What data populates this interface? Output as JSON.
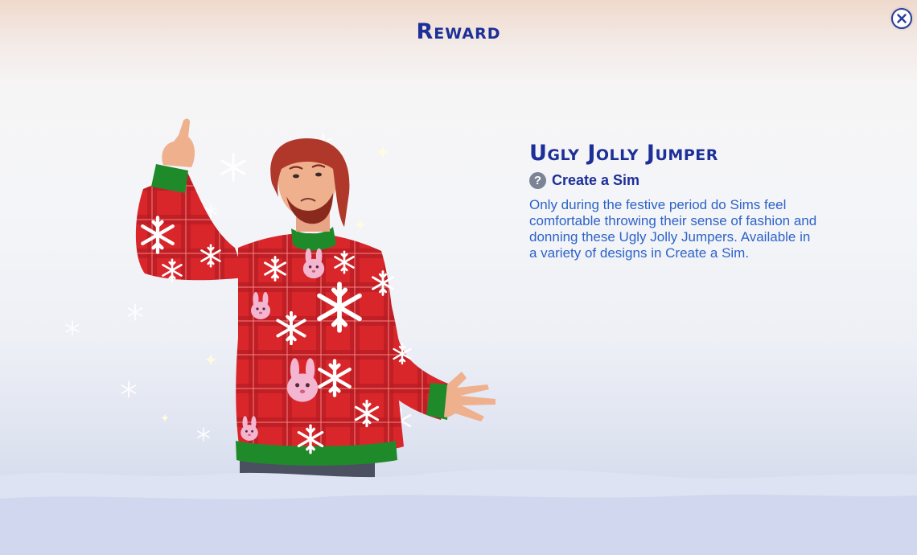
{
  "dialog": {
    "title": "Reward",
    "close_icon": "close-x-icon"
  },
  "reward": {
    "name": "Ugly Jolly Jumper",
    "category_icon": "question-help-icon",
    "category": "Create a Sim",
    "description": "Only during the festive period do Sims feel comfortable throwing their sense of fashion and donning these Ugly Jolly Jumpers. Available in a variety of designs in Create a Sim."
  },
  "colors": {
    "title_blue": "#1d2f98",
    "body_blue": "#2d63c8",
    "sweater_red": "#d42a2e",
    "cuff_green": "#1f8a2a",
    "snow": "#e3e8f5"
  },
  "illustration": {
    "subject": "sim-wearing-christmas-sweater",
    "background": "snowy-scene-with-snowflakes"
  }
}
